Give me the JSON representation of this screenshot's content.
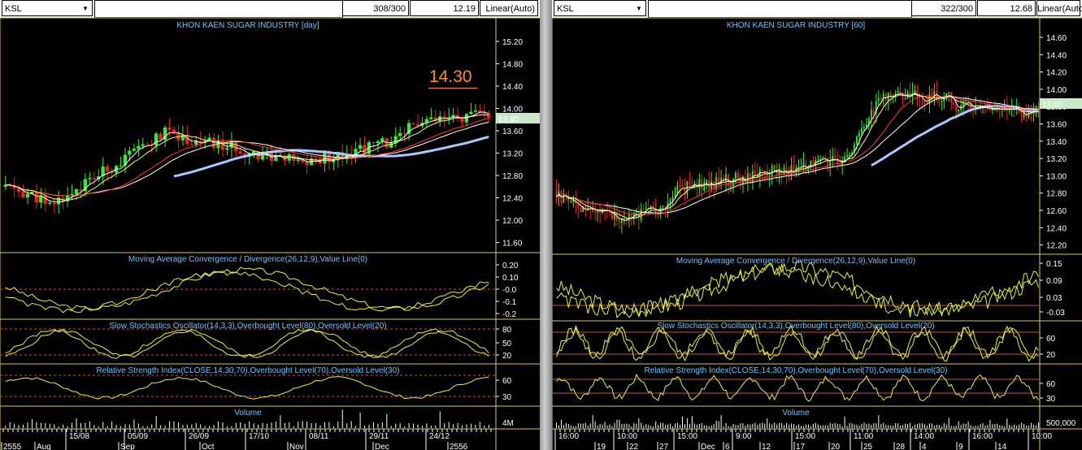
{
  "left": {
    "symbol": "KSL",
    "count": "308/300",
    "last": "12.19",
    "scale": "Linear(Auto)",
    "title": "KHON KAEN SUGAR INDUSTRY [day]",
    "annotation": "14.30",
    "price_label": "13.90",
    "price_ticks": [
      "15.20",
      "14.80",
      "14.40",
      "14.00",
      "13.60",
      "13.20",
      "12.80",
      "12.40",
      "12.00",
      "11.60"
    ],
    "macd_title": "Moving Average Convergence / Divergence(26,12,9),Value Line(0)",
    "macd_ticks": [
      "0.20",
      "0.10",
      "-0.0",
      "-0.1",
      "-0.2"
    ],
    "stoch_title": "Slow Stochastics Oscillator(14,3,3),Overbought Level(80),Oversold Level(20)",
    "stoch_ticks": [
      "80",
      "50",
      "20"
    ],
    "rsi_title": "Relative Strength Index(CLOSE,14,30,70),Overbought Level(70),Oversold Level(30)",
    "rsi_ticks": [
      "60",
      "30"
    ],
    "volume_title": "Volume",
    "volume_tick": "4M",
    "date_top": [
      "15/08",
      "05/09",
      "26/09",
      "17/10",
      "08/11",
      "29/11",
      "24/12"
    ],
    "date_bottom": [
      "2555",
      "Aug",
      "Sep",
      "Oct",
      "Nov",
      "Dec",
      "2556"
    ]
  },
  "right": {
    "symbol": "KSL",
    "count": "322/300",
    "last": "12.68",
    "scale": "Linear(Auto)",
    "title": "KHON KAEN SUGAR INDUSTRY [60]",
    "price_label": "13.90",
    "price_ticks": [
      "14.60",
      "14.40",
      "14.20",
      "14.00",
      "13.80",
      "13.60",
      "13.40",
      "13.20",
      "13.00",
      "12.80",
      "12.60",
      "12.40",
      "12.20"
    ],
    "macd_title": "Moving Average Convergence / Divergence(26,12,9),Value Line(0)",
    "macd_ticks": [
      "0.15",
      "0.09",
      "0.03",
      "-0.03"
    ],
    "stoch_title": "Slow Stochastics Oscillator(14,3,3),Overbought Level(80),Oversold Level(20)",
    "stoch_ticks": [
      "60",
      "20"
    ],
    "rsi_title": "Relative Strength Index(CLOSE,14,30,70),Overbought Level(70),Oversold Level(30)",
    "rsi_ticks": [
      "60",
      "30"
    ],
    "volume_title": "Volume",
    "volume_tick": "500,000",
    "date_top": [
      "16:00",
      "10:00",
      "15:00",
      "9:00",
      "15:00",
      "11:00",
      "14:00",
      "16:00",
      "10:00"
    ],
    "date_bottom": [
      "19",
      "22",
      "27",
      "Dec",
      "6",
      "12",
      "17",
      "20",
      "25",
      "28",
      "4",
      "9",
      "14"
    ]
  },
  "colors": {
    "up": "#33ee33",
    "down": "#ee2222",
    "ma_fast": "#ffffff",
    "ma_mid": "#ffff66",
    "ma_slow": "#ff3333",
    "ma_long": "#ffffff",
    "ma_trend": "#a9c8ff",
    "osc": "#e8f040",
    "level": "#c05050",
    "title": "#6fc3ff",
    "grid_line": "#d4c85a"
  }
}
